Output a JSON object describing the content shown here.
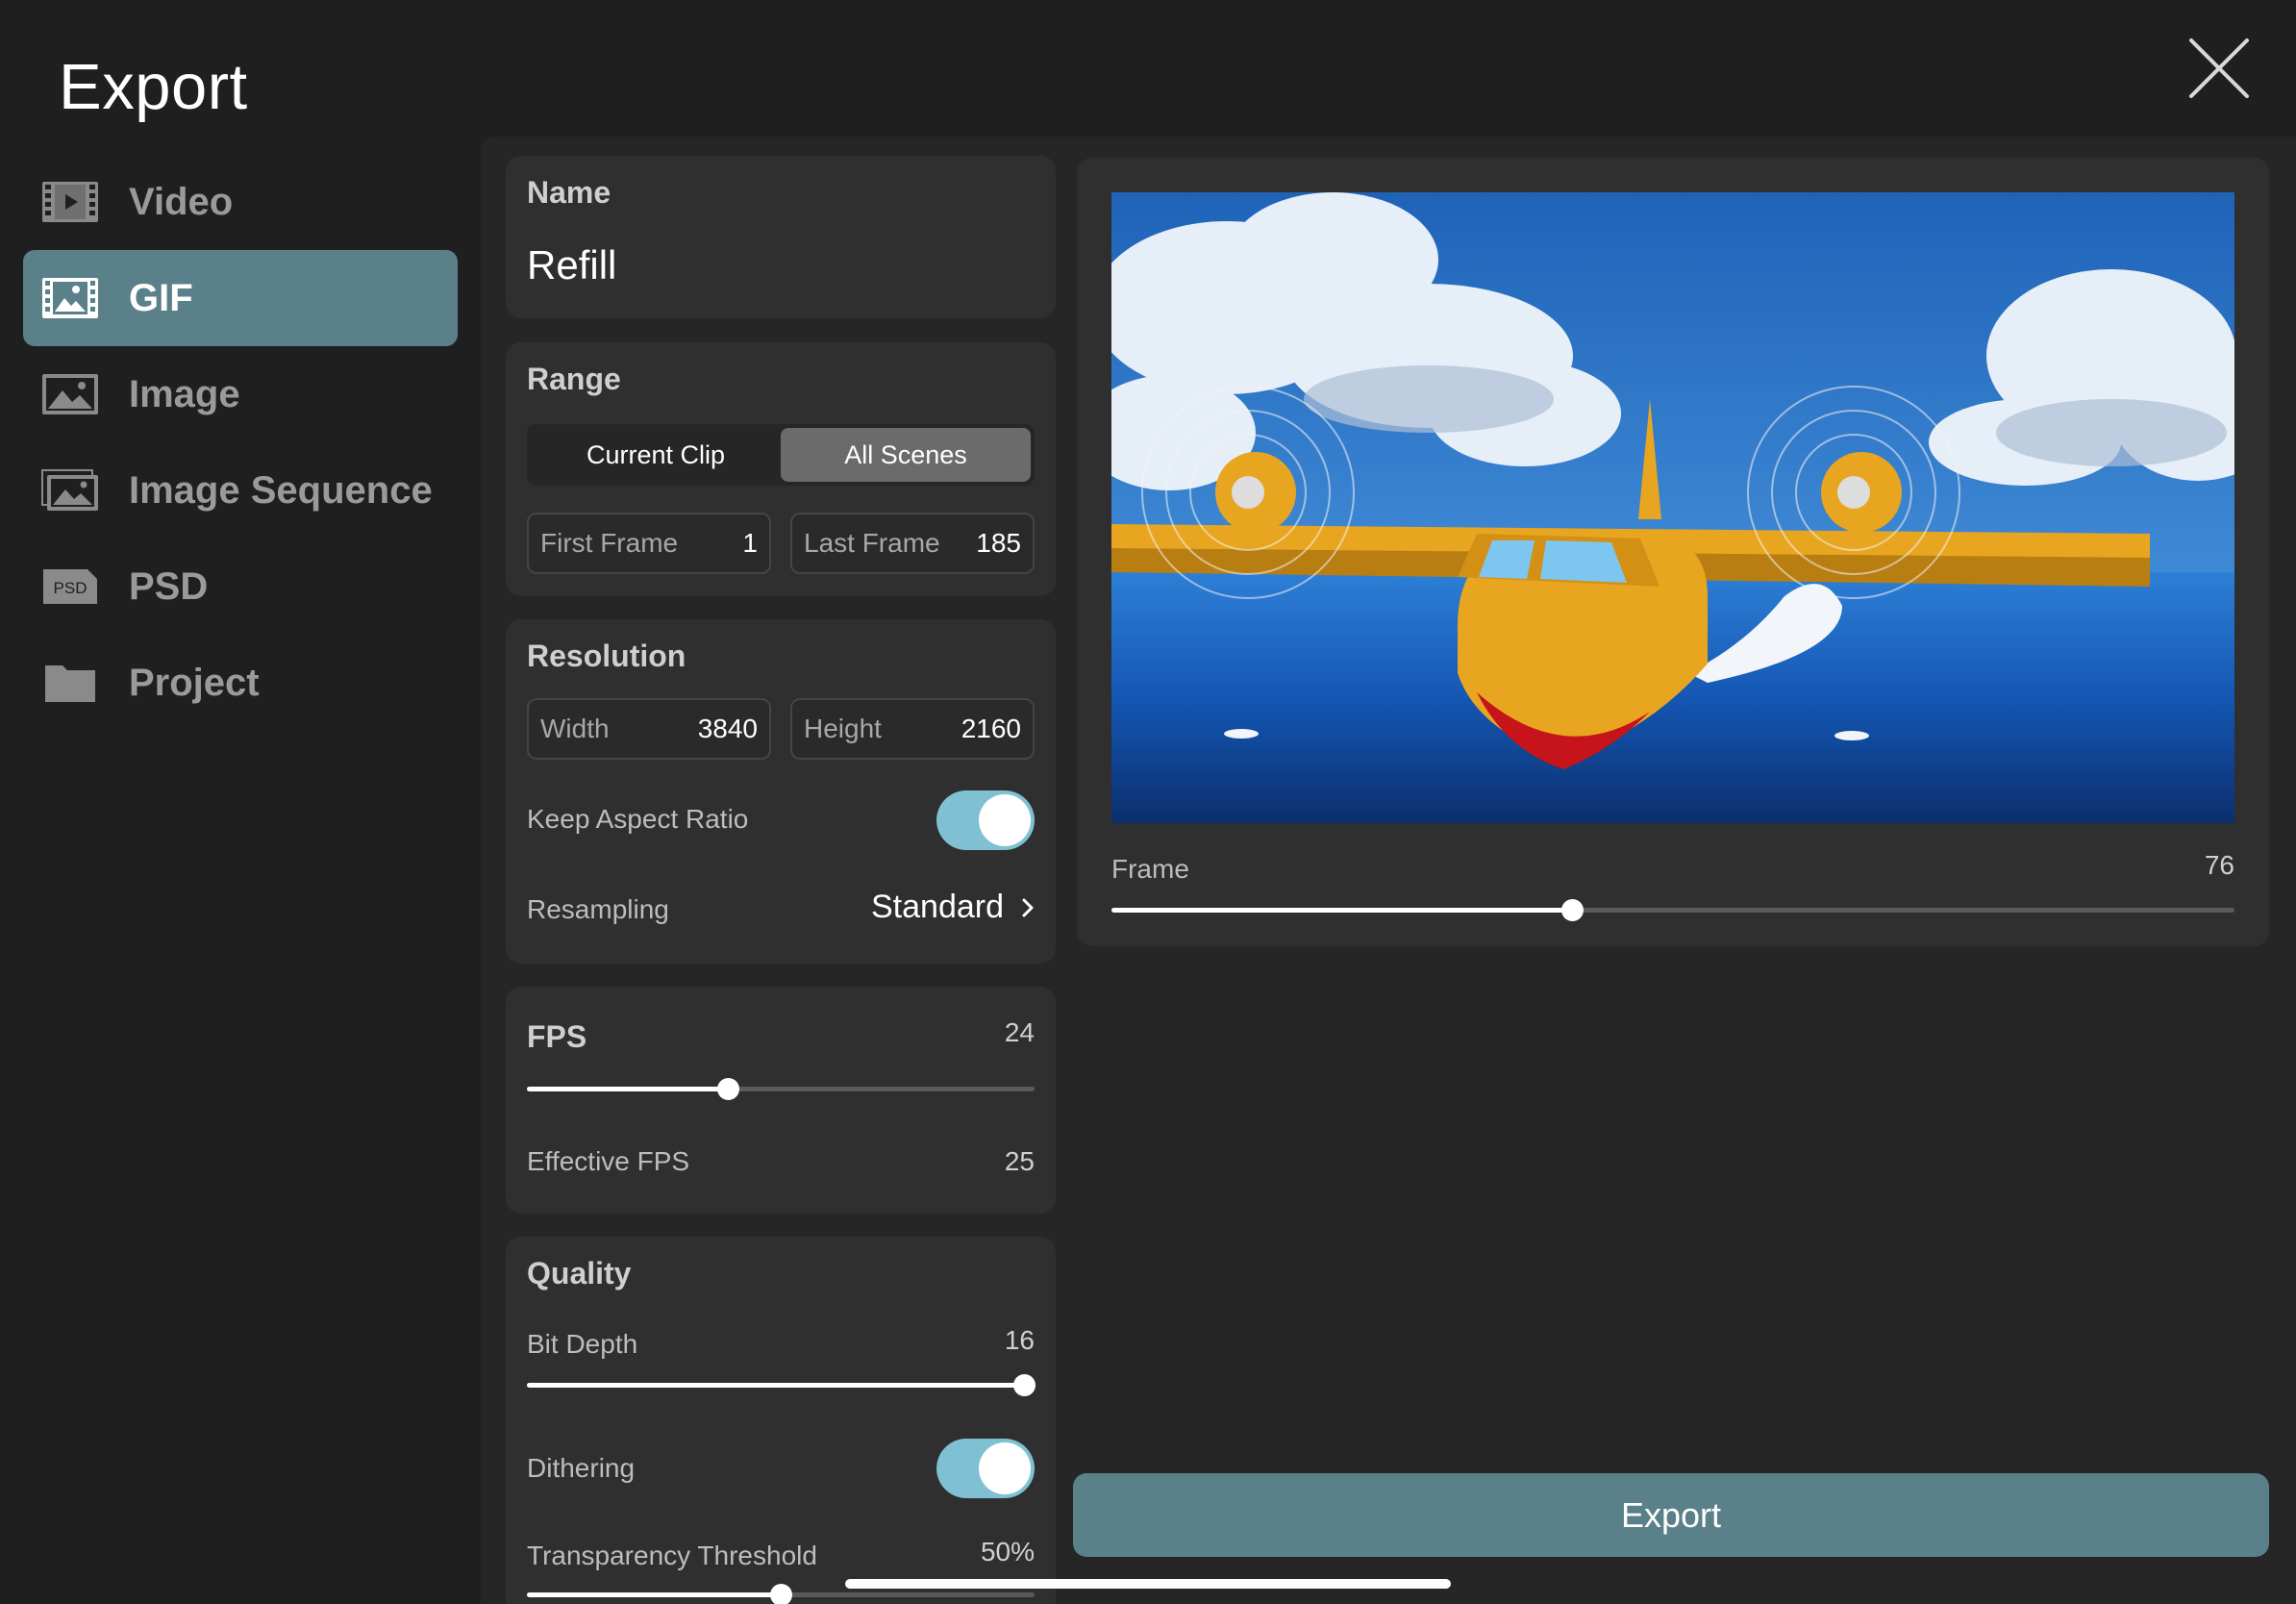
{
  "header": {
    "title": "Export"
  },
  "sidebar": {
    "items": [
      {
        "label": "Video",
        "icon": "video-icon"
      },
      {
        "label": "GIF",
        "icon": "gif-icon",
        "active": true
      },
      {
        "label": "Image",
        "icon": "image-icon"
      },
      {
        "label": "Image Sequence",
        "icon": "image-sequence-icon"
      },
      {
        "label": "PSD",
        "icon": "psd-icon",
        "icon_text": "PSD"
      },
      {
        "label": "Project",
        "icon": "folder-icon"
      }
    ]
  },
  "name_card": {
    "title": "Name",
    "value": "Refill"
  },
  "range_card": {
    "title": "Range",
    "segments": [
      "Current Clip",
      "All Scenes"
    ],
    "selected_segment": "All Scenes",
    "first_frame": {
      "label": "First Frame",
      "value": "1"
    },
    "last_frame": {
      "label": "Last Frame",
      "value": "185"
    }
  },
  "resolution_card": {
    "title": "Resolution",
    "width": {
      "label": "Width",
      "value": "3840"
    },
    "height": {
      "label": "Height",
      "value": "2160"
    },
    "keep_aspect": {
      "label": "Keep Aspect Ratio",
      "on": true
    },
    "resampling": {
      "label": "Resampling",
      "value": "Standard"
    }
  },
  "fps_card": {
    "title": "FPS",
    "value": "24",
    "slider_fraction": 0.395,
    "effective": {
      "label": "Effective FPS",
      "value": "25"
    }
  },
  "quality_card": {
    "title": "Quality",
    "bit_depth": {
      "label": "Bit Depth",
      "value": "16",
      "slider_fraction": 0.98
    },
    "dithering": {
      "label": "Dithering",
      "on": true
    },
    "transparency": {
      "label": "Transparency Threshold",
      "value": "50%",
      "slider_fraction": 0.5
    }
  },
  "preview": {
    "frame_label": "Frame",
    "frame_value": "76",
    "slider_fraction": 0.41
  },
  "actions": {
    "export_label": "Export"
  },
  "colors": {
    "accent": "#5a8089",
    "toggle": "#7fc0d2",
    "background": "#1f1f1f",
    "card": "#2f2f2f"
  }
}
